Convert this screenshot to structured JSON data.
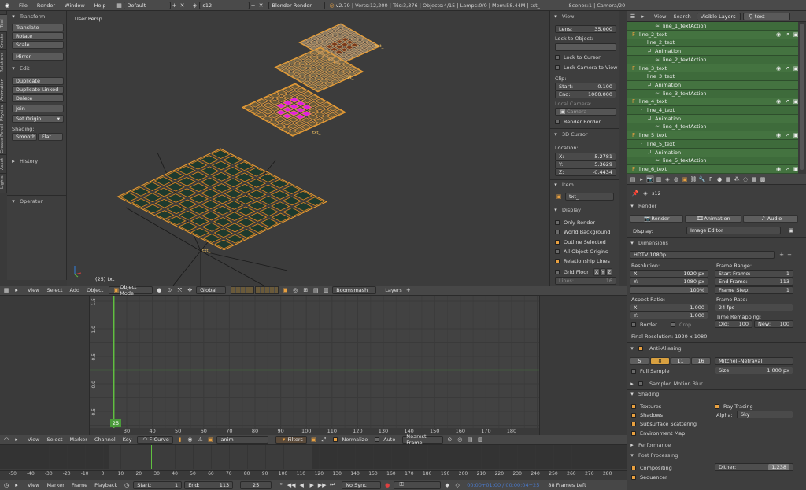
{
  "topbar": {
    "menus": [
      "File",
      "Render",
      "Window",
      "Help"
    ],
    "layout": "Default",
    "scene": "s12",
    "engine": "Blender Render",
    "stats": "v2.79 | Verts:12,200 | Tris:3,376 | Objects:4/15 | Lamps:0/0 | Mem:58.44M | txt_",
    "scene_info": "Scenes:1 | Camera/20"
  },
  "tool_tabs": [
    "Tool",
    "Create",
    "Relations",
    "Animation",
    "Physics",
    "Grease Pencil",
    "Asset",
    "Lights"
  ],
  "toolshelf": {
    "transform_header": "Transform",
    "transform": [
      "Translate",
      "Rotate",
      "Scale"
    ],
    "mirror": "Mirror",
    "edit_header": "Edit",
    "edit": [
      "Duplicate",
      "Duplicate Linked",
      "Delete"
    ],
    "join": "Join",
    "set_origin": "Set Origin",
    "shading_label": "Shading:",
    "smooth": "Smooth",
    "flat": "Flat",
    "history_header": "History",
    "operator_header": "Operator"
  },
  "viewport": {
    "label": "User Persp",
    "object_label": "(25) txt_",
    "obj_tags": [
      "txt_",
      "txt_",
      "txt_",
      "txt_"
    ],
    "header": {
      "menus": [
        "View",
        "Select",
        "Add",
        "Object"
      ],
      "mode": "Object Mode",
      "orientation": "Global",
      "snap": "Boomsmash",
      "layers": "Layers"
    }
  },
  "npanel": {
    "view_header": "View",
    "lens_label": "Lens:",
    "lens": "35.000",
    "lock_to_object": "Lock to Object:",
    "lock_cursor": "Lock to Cursor",
    "lock_camera": "Lock Camera to View",
    "clip": "Clip:",
    "start_label": "Start:",
    "start": "0.100",
    "end_label": "End:",
    "end": "1000.000",
    "local_camera": "Local Camera:",
    "camera": "Camera",
    "render_border": "Render Border",
    "cursor_header": "3D Cursor",
    "location": "Location:",
    "x_label": "X:",
    "x": "5.2781",
    "y_label": "Y:",
    "y": "5.3629",
    "z_label": "Z:",
    "z": "-0.4434",
    "item_header": "Item",
    "item_name": "txt_",
    "display_header": "Display",
    "only_render": "Only Render",
    "world_bg": "World Background",
    "outline_selected": "Outline Selected",
    "all_origins": "All Object Origins",
    "relationship_lines": "Relationship Lines",
    "grid_floor": "Grid Floor",
    "axes": [
      "X",
      "Y",
      "Z"
    ],
    "lines_label": "Lines:",
    "lines": "16"
  },
  "graph": {
    "y_ticks": [
      "1.5",
      "1.0",
      "0.5",
      "0.0",
      "-0.5"
    ],
    "x_ticks": [
      "30",
      "40",
      "50",
      "60",
      "70",
      "80",
      "90",
      "100",
      "110",
      "120",
      "130",
      "140",
      "150",
      "160",
      "170",
      "180"
    ],
    "current_frame": "25",
    "header": {
      "menus": [
        "View",
        "Select",
        "Marker",
        "Channel",
        "Key"
      ],
      "mode": "F-Curve",
      "action": "anim",
      "filters": "Filters",
      "normalize": "Normalize",
      "auto": "Auto",
      "snap": "Nearest Frame"
    }
  },
  "timeline": {
    "ticks": [
      "-50",
      "-40",
      "-30",
      "-20",
      "-10",
      "0",
      "10",
      "20",
      "30",
      "40",
      "50",
      "60",
      "70",
      "80",
      "90",
      "100",
      "110",
      "120",
      "130",
      "140",
      "150",
      "160",
      "170",
      "180",
      "190",
      "200",
      "210",
      "220",
      "230",
      "240",
      "250",
      "260",
      "270",
      "280"
    ],
    "menus": [
      "View",
      "Marker",
      "Frame",
      "Playback"
    ],
    "start_label": "Start:",
    "start": "1",
    "end_label": "End:",
    "end": "113",
    "current": "25",
    "sync": "No Sync",
    "time_text": "00:00+01:00 / 00:00:04+25",
    "frames_left": "88 Frames Left"
  },
  "outliner": {
    "menus": [
      "View",
      "Search"
    ],
    "filter": "Visible Layers",
    "search": "text",
    "rows": [
      {
        "indent": 3,
        "label": "line_1_textAction",
        "icon": "≈"
      },
      {
        "indent": 0,
        "label": "line_2_text",
        "icon": "F"
      },
      {
        "indent": 1,
        "label": "line_2_text",
        "icon": "·"
      },
      {
        "indent": 2,
        "label": "Animation",
        "icon": "↲"
      },
      {
        "indent": 3,
        "label": "line_2_textAction",
        "icon": "≈"
      },
      {
        "indent": 0,
        "label": "line_3_text",
        "icon": "F"
      },
      {
        "indent": 1,
        "label": "line_3_text",
        "icon": "·"
      },
      {
        "indent": 2,
        "label": "Animation",
        "icon": "↲"
      },
      {
        "indent": 3,
        "label": "line_3_textAction",
        "icon": "≈"
      },
      {
        "indent": 0,
        "label": "line_4_text",
        "icon": "F"
      },
      {
        "indent": 1,
        "label": "line_4_text",
        "icon": "·"
      },
      {
        "indent": 2,
        "label": "Animation",
        "icon": "↲"
      },
      {
        "indent": 3,
        "label": "line_4_textAction",
        "icon": "≈"
      },
      {
        "indent": 0,
        "label": "line_5_text",
        "icon": "F"
      },
      {
        "indent": 1,
        "label": "line_5_text",
        "icon": "·"
      },
      {
        "indent": 2,
        "label": "Animation",
        "icon": "↲"
      },
      {
        "indent": 3,
        "label": "line_5_textAction",
        "icon": "≈"
      },
      {
        "indent": 0,
        "label": "line_6_text",
        "icon": "F"
      }
    ]
  },
  "properties": {
    "scene_name": "s12",
    "render_header": "Render",
    "render_btn": "Render",
    "animation_btn": "Animation",
    "audio_btn": "Audio",
    "display_label": "Display:",
    "display_value": "Image Editor",
    "dimensions_header": "Dimensions",
    "preset": "HDTV 1080p",
    "resolution": "Resolution:",
    "res_x_label": "X:",
    "res_x": "1920 px",
    "res_y_label": "Y:",
    "res_y": "1080 px",
    "res_pct": "100%",
    "frame_range": "Frame Range:",
    "start_frame_label": "Start Frame:",
    "start_frame": "1",
    "end_frame_label": "End Frame:",
    "end_frame": "113",
    "frame_step_label": "Frame Step:",
    "frame_step": "1",
    "aspect": "Aspect Ratio:",
    "asp_x_label": "X:",
    "asp_x": "1.000",
    "asp_y_label": "Y:",
    "asp_y": "1.000",
    "frame_rate": "Frame Rate:",
    "fps": "24 fps",
    "time_remap": "Time Remapping:",
    "old_label": "Old:",
    "old": "100",
    "new_label": "New:",
    "new": "100",
    "border": "Border",
    "crop": "Crop",
    "final_res": "Final Resolution: 1920 x 1080",
    "aa_header": "Anti-Aliasing",
    "aa_samples": [
      "5",
      "8",
      "11",
      "16"
    ],
    "aa_filter": "Mitchell-Netravali",
    "full_sample": "Full Sample",
    "size_label": "Size:",
    "size": "1.000 px",
    "smb_header": "Sampled Motion Blur",
    "shading_header": "Shading",
    "textures": "Textures",
    "ray_tracing": "Ray Tracing",
    "shadows": "Shadows",
    "alpha_label": "Alpha:",
    "alpha": "Sky",
    "sss": "Subsurface Scattering",
    "env_map": "Environment Map",
    "performance_header": "Performance",
    "post_header": "Post Processing",
    "compositing": "Compositing",
    "dither_label": "Dither:",
    "dither": "1.238",
    "sequencer": "Sequencer"
  }
}
